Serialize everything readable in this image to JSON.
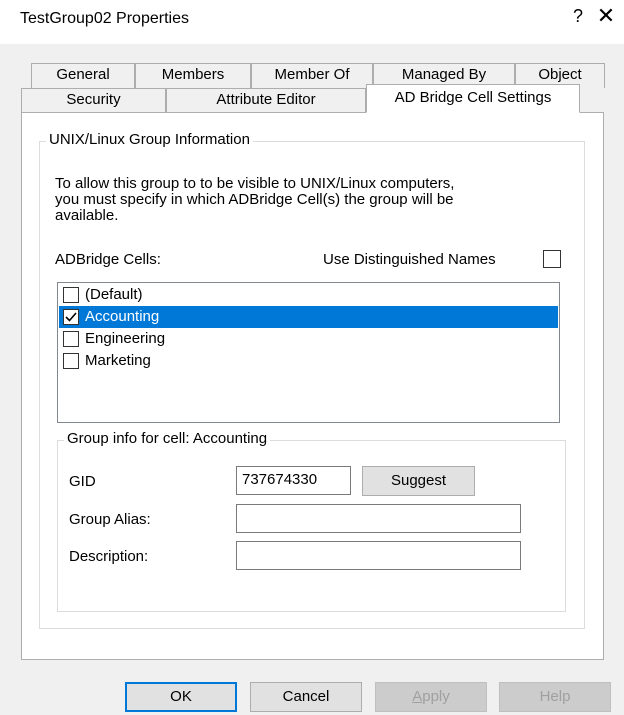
{
  "window": {
    "title": "TestGroup02 Properties",
    "help_glyph": "?",
    "close_glyph": "✕"
  },
  "tabs": {
    "row1": [
      "General",
      "Members",
      "Member Of",
      "Managed By",
      "Object"
    ],
    "row2": [
      "Security",
      "Attribute Editor",
      "AD Bridge Cell Settings"
    ],
    "active": "AD Bridge Cell Settings"
  },
  "unix_group": {
    "legend": "UNIX/Linux Group Information",
    "description": "To allow this group to to be visible to UNIX/Linux computers, you must specify in which ADBridge Cell(s) the group will be available.",
    "description_lines": [
      "To allow this group to to be visible to UNIX/Linux computers,",
      "you must specify in which ADBridge Cell(s) the group will be",
      "available."
    ],
    "cells_label": "ADBridge Cells:",
    "use_dn_label": "Use Distinguished Names",
    "use_dn_checked": false,
    "cells": [
      {
        "label": "(Default)",
        "checked": false,
        "selected": false
      },
      {
        "label": "Accounting",
        "checked": true,
        "selected": true
      },
      {
        "label": "Engineering",
        "checked": false,
        "selected": false
      },
      {
        "label": "Marketing",
        "checked": false,
        "selected": false
      }
    ]
  },
  "cell_info": {
    "legend": "Group info for cell: Accounting",
    "gid_label": "GID",
    "gid_value": "737674330",
    "suggest_label": "Suggest",
    "alias_label": "Group Alias:",
    "alias_value": "",
    "description_label": "Description:",
    "description_value": ""
  },
  "buttons": {
    "ok": "OK",
    "cancel": "Cancel",
    "apply": "Apply",
    "help": "Help"
  },
  "colors": {
    "accent": "#0078d7",
    "background": "#f0f0f0"
  }
}
